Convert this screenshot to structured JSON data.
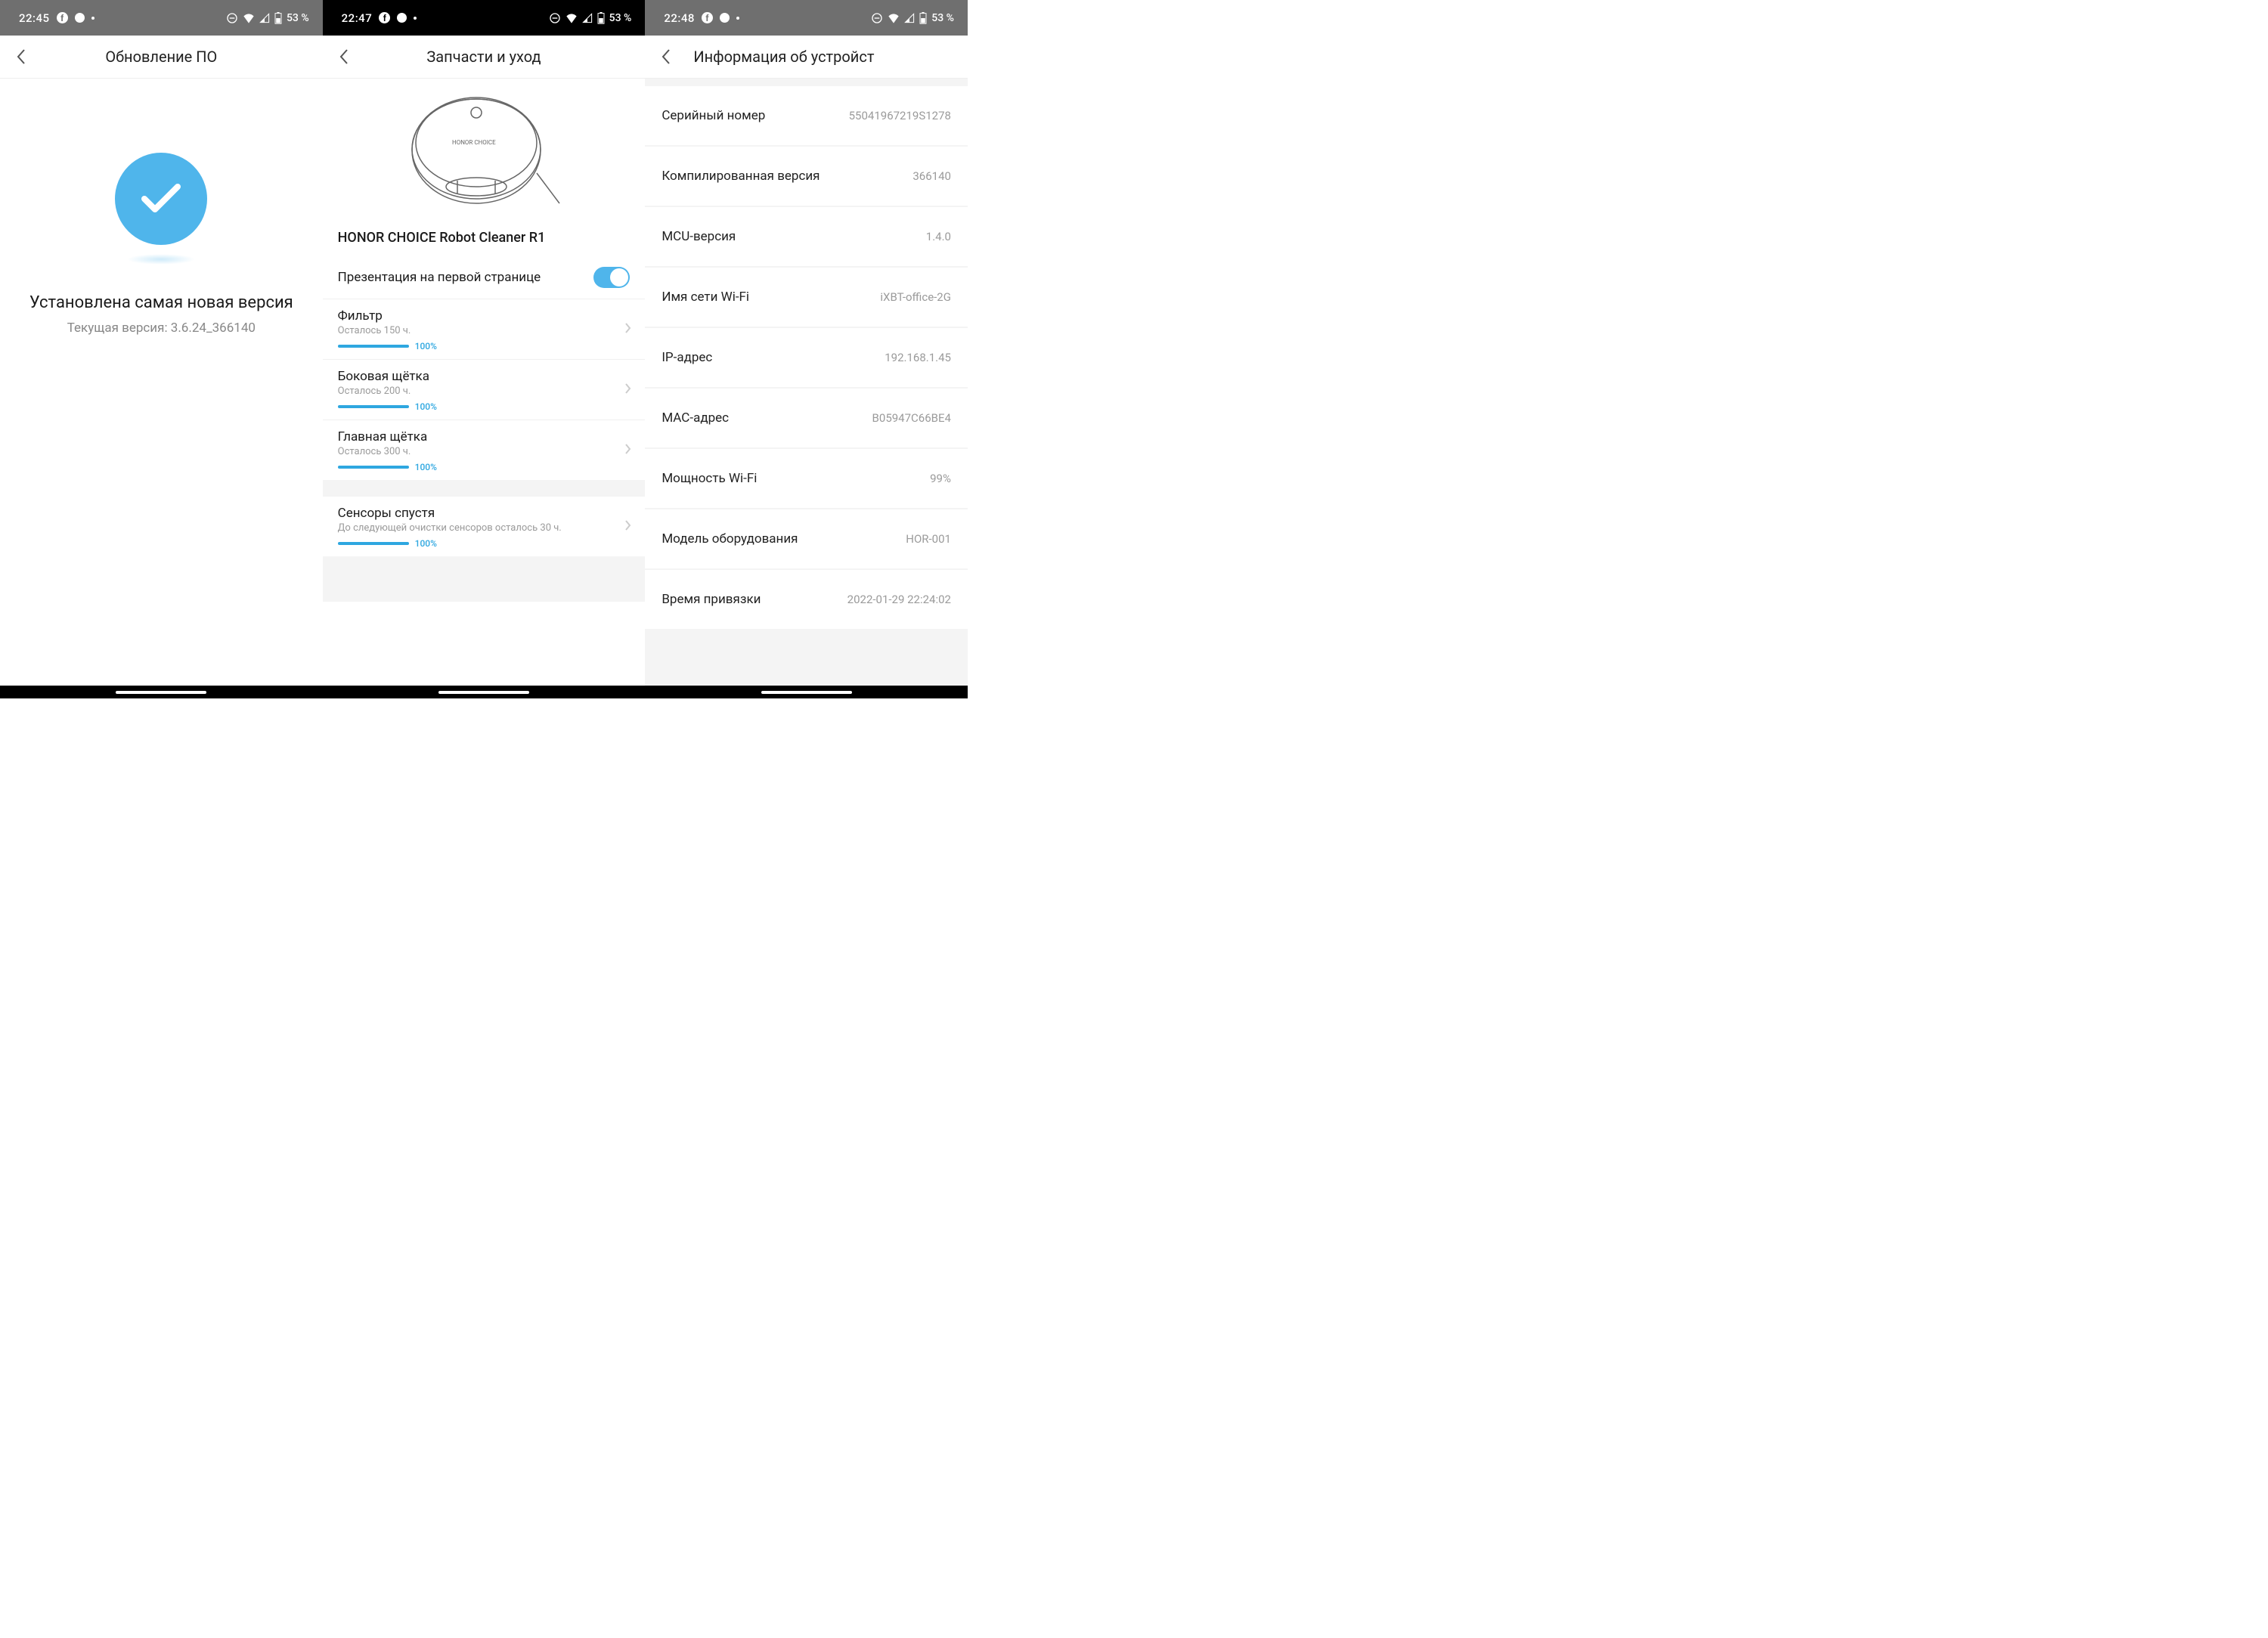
{
  "screen1": {
    "statusbar": {
      "time": "22:45",
      "battery": "53 %"
    },
    "title": "Обновление ПО",
    "status_main": "Установлена самая новая версия",
    "status_sub": "Текущая версия: 3.6.24_366140"
  },
  "screen2": {
    "statusbar": {
      "time": "22:47",
      "battery": "53 %"
    },
    "title": "Запчасти и уход",
    "device_name": "HONOR CHOICE Robot Cleaner R1",
    "toggle_label": "Презентация на первой странице",
    "parts": [
      {
        "name": "Фильтр",
        "sub": "Осталось 150 ч.",
        "pct": "100%"
      },
      {
        "name": "Боковая щётка",
        "sub": "Осталось 200 ч.",
        "pct": "100%"
      },
      {
        "name": "Главная щётка",
        "sub": "Осталось 300 ч.",
        "pct": "100%"
      },
      {
        "name": "Сенсоры спустя",
        "sub": "До следующей очистки сенсоров осталось 30 ч.",
        "pct": "100%"
      }
    ]
  },
  "screen3": {
    "statusbar": {
      "time": "22:48",
      "battery": "53 %"
    },
    "title": "Информация об устройст",
    "rows": [
      {
        "label": "Серийный номер",
        "value": "55041967219S1278"
      },
      {
        "label": "Компилированная версия",
        "value": "366140"
      },
      {
        "label": "MCU-версия",
        "value": "1.4.0"
      },
      {
        "label": "Имя сети Wi-Fi",
        "value": "iXBT-office-2G"
      },
      {
        "label": "IP-адрес",
        "value": "192.168.1.45"
      },
      {
        "label": "MAC-адрес",
        "value": "B05947C66BE4"
      },
      {
        "label": "Мощность Wi-Fi",
        "value": "99%"
      },
      {
        "label": "Модель оборудования",
        "value": "HOR-001"
      },
      {
        "label": "Время привязки",
        "value": "2022-01-29 22:24:02"
      }
    ]
  }
}
